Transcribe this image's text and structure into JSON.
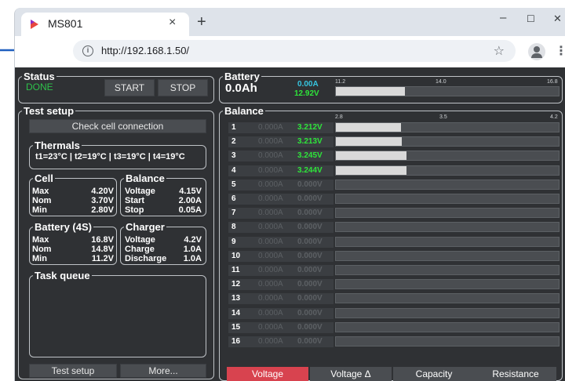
{
  "browser": {
    "tab_title": "MS801",
    "tab_close": "×",
    "new_tab": "+",
    "url": "http://192.168.1.50/",
    "minimize": "–",
    "maximize": "☐",
    "close": "✕",
    "info": "i",
    "star": "☆",
    "menu": "⋮"
  },
  "status": {
    "legend": "Status",
    "state": "DONE",
    "state_color": "#2ec14b",
    "start_label": "START",
    "stop_label": "STOP"
  },
  "test_setup": {
    "legend": "Test setup",
    "check_label": "Check cell connection",
    "thermals_legend": "Thermals",
    "thermals_text": "t1=23°C | t2=19°C | t3=19°C | t4=19°C",
    "cell": {
      "legend": "Cell",
      "rows": [
        {
          "k": "Max",
          "v": "4.20V"
        },
        {
          "k": "Nom",
          "v": "3.70V"
        },
        {
          "k": "Min",
          "v": "2.80V"
        }
      ]
    },
    "balance": {
      "legend": "Balance",
      "rows": [
        {
          "k": "Voltage",
          "v": "4.15V"
        },
        {
          "k": "Start",
          "v": "2.00A"
        },
        {
          "k": "Stop",
          "v": "0.05A"
        }
      ]
    },
    "battery": {
      "legend": "Battery (4S)",
      "rows": [
        {
          "k": "Max",
          "v": "16.8V"
        },
        {
          "k": "Nom",
          "v": "14.8V"
        },
        {
          "k": "Min",
          "v": "11.2V"
        }
      ]
    },
    "charger": {
      "legend": "Charger",
      "rows": [
        {
          "k": "Voltage",
          "v": "4.2V"
        },
        {
          "k": "Charge",
          "v": "1.0A"
        },
        {
          "k": "Discharge",
          "v": "1.0A"
        }
      ]
    },
    "task_queue_legend": "Task queue",
    "test_setup_button": "Test setup",
    "more_button": "More..."
  },
  "battery": {
    "legend": "Battery",
    "capacity": "0.0Ah",
    "current": "0.00A",
    "voltage": "12.92V",
    "scale_min": "11.2",
    "scale_mid": "14.0",
    "scale_max": "16.8",
    "level_fraction": 0.31
  },
  "balance": {
    "legend": "Balance",
    "scale_min": "2.8",
    "scale_mid": "3.5",
    "scale_max": "4.2",
    "rows": [
      {
        "n": "1",
        "cur": "0.000A",
        "volt": "3.212V",
        "on": true,
        "fill": 0.294
      },
      {
        "n": "2",
        "cur": "0.000A",
        "volt": "3.213V",
        "on": true,
        "fill": 0.295
      },
      {
        "n": "3",
        "cur": "0.000A",
        "volt": "3.245V",
        "on": true,
        "fill": 0.318
      },
      {
        "n": "4",
        "cur": "0.000A",
        "volt": "3.244V",
        "on": true,
        "fill": 0.317
      },
      {
        "n": "5",
        "cur": "0.000A",
        "volt": "0.000V",
        "on": false,
        "fill": 0
      },
      {
        "n": "6",
        "cur": "0.000A",
        "volt": "0.000V",
        "on": false,
        "fill": 0
      },
      {
        "n": "7",
        "cur": "0.000A",
        "volt": "0.000V",
        "on": false,
        "fill": 0
      },
      {
        "n": "8",
        "cur": "0.000A",
        "volt": "0.000V",
        "on": false,
        "fill": 0
      },
      {
        "n": "9",
        "cur": "0.000A",
        "volt": "0.000V",
        "on": false,
        "fill": 0
      },
      {
        "n": "10",
        "cur": "0.000A",
        "volt": "0.000V",
        "on": false,
        "fill": 0
      },
      {
        "n": "11",
        "cur": "0.000A",
        "volt": "0.000V",
        "on": false,
        "fill": 0
      },
      {
        "n": "12",
        "cur": "0.000A",
        "volt": "0.000V",
        "on": false,
        "fill": 0
      },
      {
        "n": "13",
        "cur": "0.000A",
        "volt": "0.000V",
        "on": false,
        "fill": 0
      },
      {
        "n": "14",
        "cur": "0.000A",
        "volt": "0.000V",
        "on": false,
        "fill": 0
      },
      {
        "n": "15",
        "cur": "0.000A",
        "volt": "0.000V",
        "on": false,
        "fill": 0
      },
      {
        "n": "16",
        "cur": "0.000A",
        "volt": "0.000V",
        "on": false,
        "fill": 0
      }
    ],
    "tabs": [
      {
        "label": "Voltage",
        "active": true
      },
      {
        "label": "Voltage Δ",
        "active": false
      },
      {
        "label": "Capacity",
        "active": false
      },
      {
        "label": "Resistance",
        "active": false
      }
    ]
  }
}
